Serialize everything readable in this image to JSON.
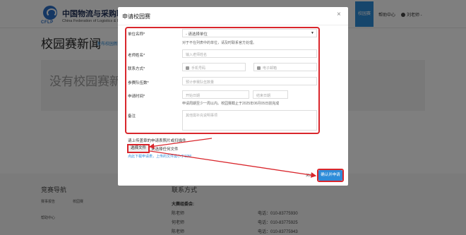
{
  "header": {
    "logo_text": "CFLP",
    "org_name": "中国物流与采购联合",
    "org_name_en": "China Federation of Logistics & Pur",
    "nav_active": "校园赛",
    "nav_help": "帮助中心",
    "user": "刘老师 -"
  },
  "page": {
    "title": "校园赛新闻",
    "publish_link": "发布校园新",
    "empty_text": "没有校园赛新闻"
  },
  "footer": {
    "guide_title": "竞赛导航",
    "links": [
      "赛事报告",
      "校园赛",
      "帮助中心"
    ],
    "contact_title": "联系方式",
    "committee": "大赛组委会:",
    "contacts": [
      {
        "name": "陈老师",
        "tel": "电话：010-83775930"
      },
      {
        "name": "何老师",
        "tel": "电话：010-83775925"
      },
      {
        "name": "陈老师",
        "tel": "电话：010-83775943"
      }
    ]
  },
  "modal": {
    "title": "申请校园赛",
    "close": "×",
    "form": {
      "unit_label": "单位名称*",
      "unit_placeholder": "- 请选择单位",
      "unit_hint": "对于不在列表中的单位，请及时联系官方处理。",
      "teacher_label": "老师姓名*",
      "teacher_placeholder": "输入老师姓名",
      "contact_label": "联系方式*",
      "phone_placeholder": "手机号码",
      "email_placeholder": "电子邮箱",
      "teams_label": "参赛队伍数*",
      "teams_placeholder": "预计参赛队伍数量",
      "time_label": "申请时间*",
      "start_placeholder": "开始日期",
      "end_placeholder": "结束日期",
      "time_hint": "申请周期至少一周以内。校园赛截止于2025年06月05日前完成",
      "remark_label": "备注",
      "remark_placeholder": "其他需补充说明事项"
    },
    "upload_note": "请上传盖章的申请表照片或扫描件",
    "choose_file": "选择文件",
    "no_file": "未选择任何文件",
    "template_note": "点此下载申请表，上传的文件需小于10M",
    "cancel": "关闭",
    "submit": "确认并申请"
  },
  "colors": {
    "accent": "#2d8cd9",
    "highlight": "#d9262c"
  }
}
